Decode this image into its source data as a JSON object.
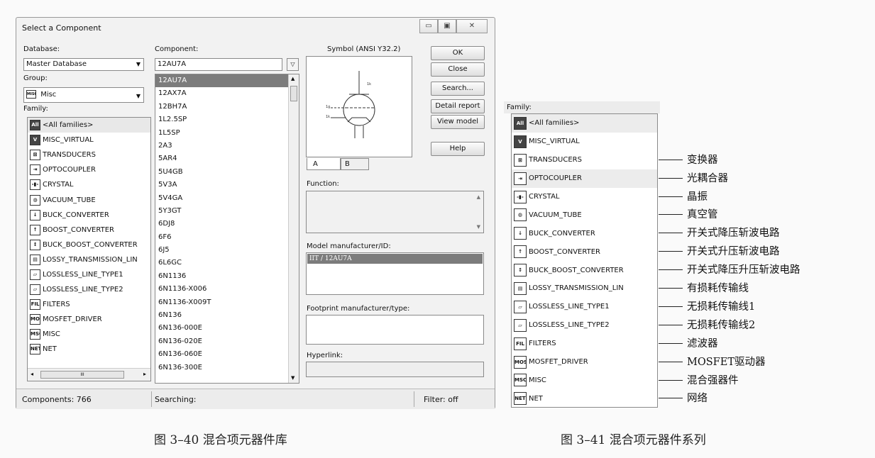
{
  "dialog": {
    "title": "Select a Component",
    "window_buttons": {
      "minimize": "▭",
      "maximize": "▣",
      "close": "✕"
    },
    "database_label": "Database:",
    "database_value": "Master Database",
    "group_label": "Group:",
    "group_icon": "MISC",
    "group_value": "Misc",
    "family_label": "Family:",
    "families": [
      {
        "icon": "All",
        "label": "<All families>"
      },
      {
        "icon": "V",
        "label": "MISC_VIRTUAL"
      },
      {
        "icon": "⊠",
        "label": "TRANSDUCERS"
      },
      {
        "icon": "⇥",
        "label": "OPTOCOUPLER"
      },
      {
        "icon": "-▮-",
        "label": "CRYSTAL"
      },
      {
        "icon": "◍",
        "label": "VACUUM_TUBE"
      },
      {
        "icon": "↓",
        "label": "BUCK_CONVERTER"
      },
      {
        "icon": "↑",
        "label": "BOOST_CONVERTER"
      },
      {
        "icon": "↕",
        "label": "BUCK_BOOST_CONVERTER"
      },
      {
        "icon": "▤",
        "label": "LOSSY_TRANSMISSION_LIN"
      },
      {
        "icon": "▱",
        "label": "LOSSLESS_LINE_TYPE1"
      },
      {
        "icon": "▱",
        "label": "LOSSLESS_LINE_TYPE2"
      },
      {
        "icon": "FIL",
        "label": "FILTERS"
      },
      {
        "icon": "MOS",
        "label": "MOSFET_DRIVER"
      },
      {
        "icon": "MSC",
        "label": "MISC"
      },
      {
        "icon": "NET",
        "label": "NET"
      }
    ],
    "hscroll_grip": "III",
    "component_label": "Component:",
    "component_value": "12AU7A",
    "components": [
      "12AU7A",
      "12AX7A",
      "12BH7A",
      "1L2.5SP",
      "1L5SP",
      "2A3",
      "5AR4",
      "5U4GB",
      "5V3A",
      "5V4GA",
      "5Y3GT",
      "6DJ8",
      "6F6",
      "6J5",
      "6L6GC",
      "6N1136",
      "6N1136-X006",
      "6N1136-X009T",
      "6N136",
      "6N136-000E",
      "6N136-020E",
      "6N136-060E",
      "6N136-300E"
    ],
    "symbol_label": "Symbol (ANSI Y32.2)",
    "symbol_tabs": [
      "A",
      "B"
    ],
    "buttons": [
      "OK",
      "Close",
      "Search...",
      "Detail report",
      "View model",
      "Help"
    ],
    "function_label": "Function:",
    "model_label": "Model manufacturer/ID:",
    "model_value": "IIT / 12AU7A",
    "footprint_label": "Footprint manufacturer/type:",
    "hyperlink_label": "Hyperlink:",
    "status": {
      "components": "Components: 766",
      "searching": "Searching:",
      "filter": "Filter: off"
    }
  },
  "caption_left": "图 3–40   混合项元器件库",
  "caption_right": "图 3–41   混合项元器件系列",
  "family_panel": {
    "header": "Family:",
    "items": [
      {
        "icon": "All",
        "label": "<All families>",
        "note": ""
      },
      {
        "icon": "V",
        "label": "MISC_VIRTUAL",
        "note": ""
      },
      {
        "icon": "⊠",
        "label": "TRANSDUCERS",
        "note": "变换器"
      },
      {
        "icon": "⇥",
        "label": "OPTOCOUPLER",
        "note": "光耦合器"
      },
      {
        "icon": "-▮-",
        "label": "CRYSTAL",
        "note": "晶振"
      },
      {
        "icon": "◍",
        "label": "VACUUM_TUBE",
        "note": "真空管"
      },
      {
        "icon": "↓",
        "label": "BUCK_CONVERTER",
        "note": "开关式降压斩波电路"
      },
      {
        "icon": "↑",
        "label": "BOOST_CONVERTER",
        "note": "开关式升压斩波电路"
      },
      {
        "icon": "↕",
        "label": "BUCK_BOOST_CONVERTER",
        "note": "开关式降压升压斩波电路"
      },
      {
        "icon": "▤",
        "label": "LOSSY_TRANSMISSION_LIN",
        "note": "有损耗传输线"
      },
      {
        "icon": "▱",
        "label": "LOSSLESS_LINE_TYPE1",
        "note": "无损耗传输线1"
      },
      {
        "icon": "▱",
        "label": "LOSSLESS_LINE_TYPE2",
        "note": "无损耗传输线2"
      },
      {
        "icon": "FIL",
        "label": "FILTERS",
        "note": "滤波器"
      },
      {
        "icon": "MOS",
        "label": "MOSFET_DRIVER",
        "note": "MOSFET驱动器"
      },
      {
        "icon": "MSC",
        "label": "MISC",
        "note": "混合强器件"
      },
      {
        "icon": "NET",
        "label": "NET",
        "note": "网络"
      }
    ]
  }
}
